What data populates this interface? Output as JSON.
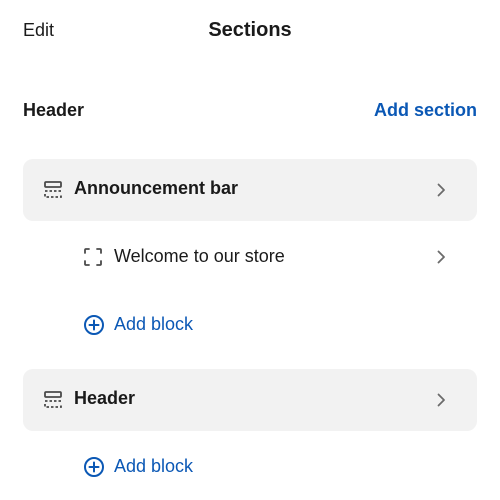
{
  "topbar": {
    "edit_label": "Edit",
    "title": "Sections"
  },
  "group": {
    "title": "Header",
    "add_section_label": "Add section"
  },
  "sections": [
    {
      "label": "Announcement bar",
      "icon": "section-layout-icon",
      "blocks": [
        {
          "label": "Welcome to our store",
          "icon": "block-frame-icon"
        }
      ],
      "add_block_label": "Add block"
    },
    {
      "label": "Header",
      "icon": "section-layout-icon",
      "blocks": [],
      "add_block_label": "Add block"
    }
  ],
  "colors": {
    "accent": "#0b58b5",
    "row_background": "#f2f2f2",
    "text": "#1a1a1a",
    "icon": "#4a4a4a",
    "chevron": "#6b6b6b"
  }
}
